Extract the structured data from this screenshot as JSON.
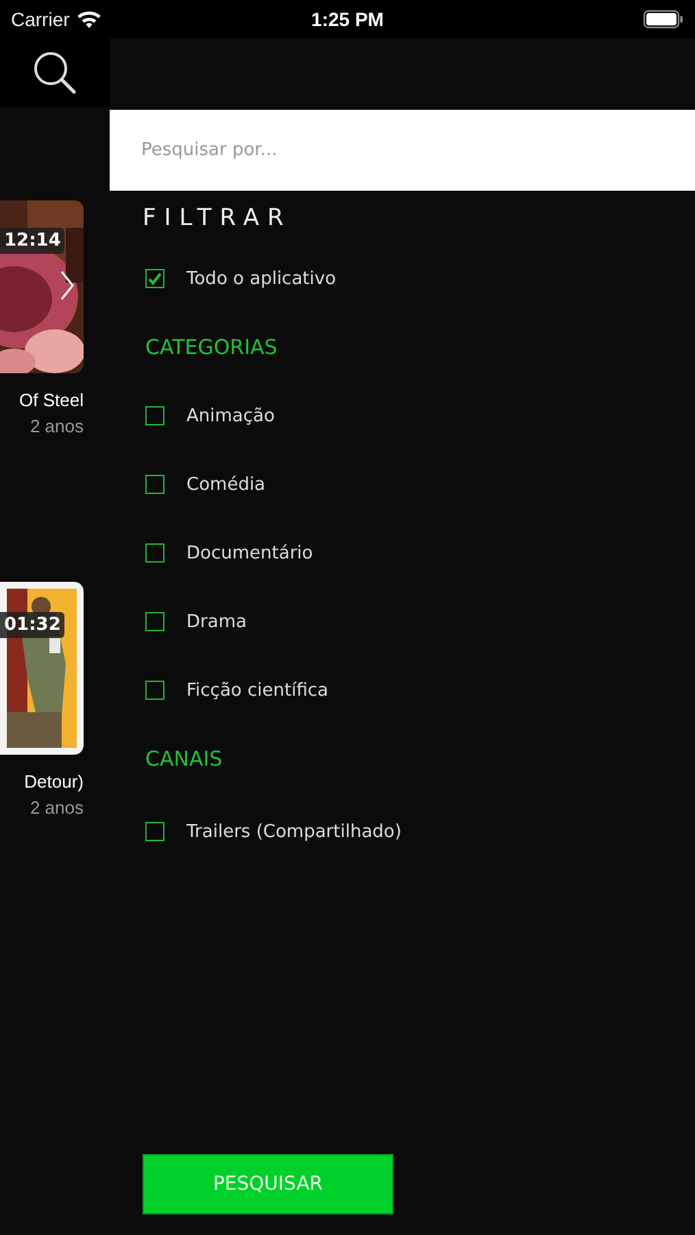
{
  "status_bar": {
    "carrier": "Carrier",
    "time": "1:25 PM"
  },
  "videos": [
    {
      "duration": "12:14",
      "title": "Of Steel",
      "age": "2 anos",
      "kind": "pink",
      "chevron": true
    },
    {
      "duration": "01:32",
      "title": "Detour)",
      "age": "2 anos",
      "kind": "poster",
      "chevron": false
    }
  ],
  "search": {
    "placeholder": "Pesquisar por..."
  },
  "filter": {
    "title": "FILTRAR",
    "items": [
      {
        "kind": "checkbox",
        "label": "Todo o aplicativo",
        "checked": true
      },
      {
        "kind": "header",
        "label": "CATEGORIAS"
      },
      {
        "kind": "checkbox",
        "label": "Animação",
        "checked": false
      },
      {
        "kind": "checkbox",
        "label": "Comédia",
        "checked": false
      },
      {
        "kind": "checkbox",
        "label": "Documentário",
        "checked": false
      },
      {
        "kind": "checkbox",
        "label": "Drama",
        "checked": false
      },
      {
        "kind": "checkbox",
        "label": "Ficção científica",
        "checked": false
      },
      {
        "kind": "header",
        "label": "CANAIS"
      },
      {
        "kind": "checkbox",
        "label": "Trailers (Compartilhado)",
        "checked": false
      }
    ]
  },
  "button": {
    "label": "PESQUISAR"
  }
}
